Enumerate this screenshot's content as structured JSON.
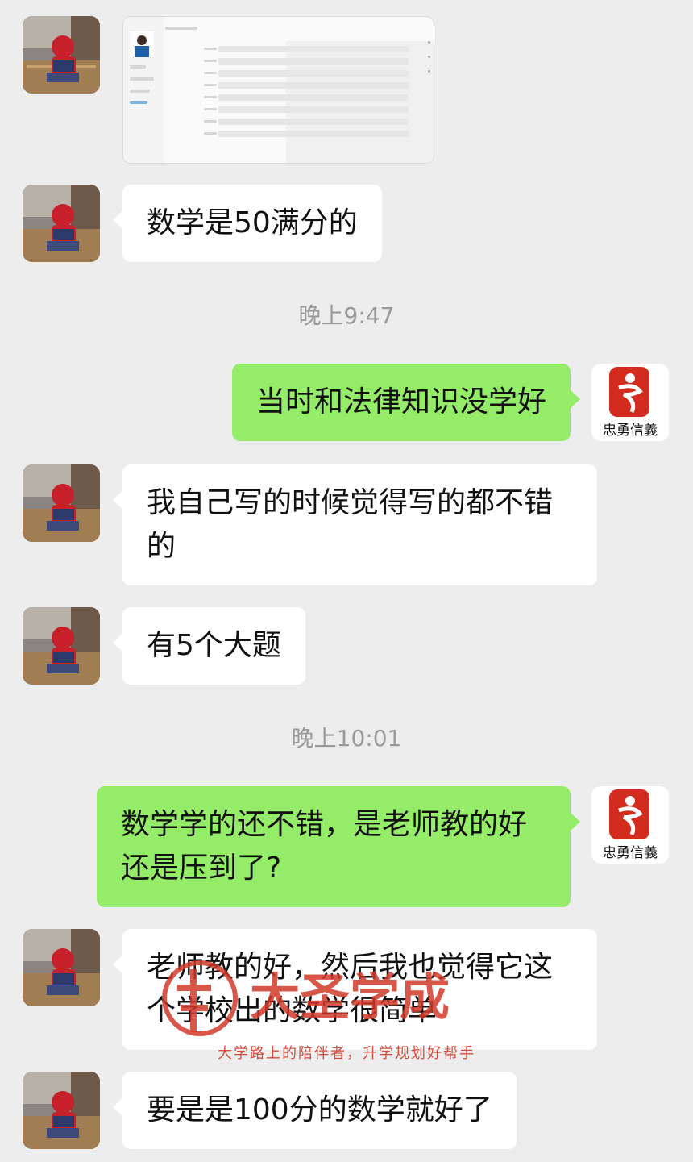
{
  "messages": [
    {
      "text": "数学是50满分的"
    },
    {
      "time": "晚上9:47"
    },
    {
      "text": "当时和法律知识没学好"
    },
    {
      "text": "我自己写的时候觉得写的都不错的"
    },
    {
      "text": "有5个大题"
    },
    {
      "time": "晚上10:01"
    },
    {
      "text": "数学学的还不错，是老师教的好还是压到了?"
    },
    {
      "text": "老师教的好，然后我也觉得它这个学校出的数学很简单"
    },
    {
      "text": "要是是100分的数学就好了"
    }
  ],
  "avatar_right": {
    "caption": "忠勇信義"
  },
  "watermark": {
    "title": "大圣学成",
    "subtitle": "大学路上的陪伴者，升学规划好帮手"
  },
  "colors": {
    "background": "#ededed",
    "outgoing": "#95ec69",
    "incoming": "#ffffff",
    "watermark": "#d23a2a"
  },
  "icons": {
    "left_avatar": "spiderman-avatar-icon",
    "right_avatar": "beijing-olympic-emblem-icon"
  }
}
